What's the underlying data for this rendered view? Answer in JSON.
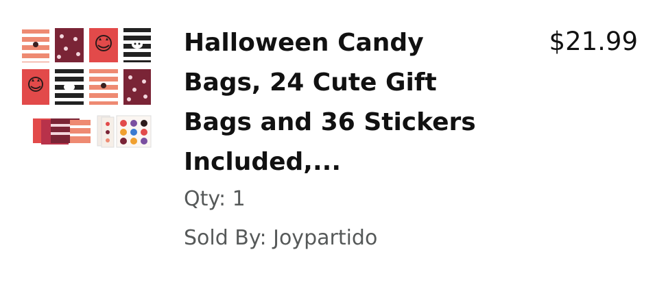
{
  "item": {
    "title": "Halloween Candy Bags, 24 Cute Gift Bags and 36 Stickers Included,...",
    "price": "$21.99",
    "qty_label": "Qty: 1",
    "sold_by_label": "Sold By: Joypartido",
    "image_icon": "halloween-candy-bags-product-image"
  }
}
